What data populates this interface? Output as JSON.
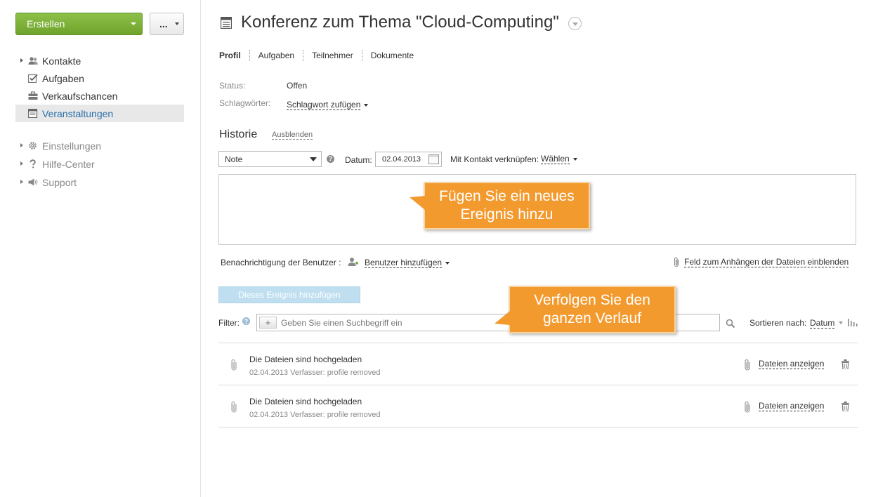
{
  "sidebar": {
    "create_label": "Erstellen",
    "more_label": "...",
    "items": [
      {
        "label": "Kontakte",
        "icon": "contacts-icon"
      },
      {
        "label": "Aufgaben",
        "icon": "tasks-icon"
      },
      {
        "label": "Verkaufschancen",
        "icon": "briefcase-icon"
      },
      {
        "label": "Veranstaltungen",
        "icon": "calendar-icon"
      }
    ],
    "secondary": [
      {
        "label": "Einstellungen",
        "icon": "gear-icon"
      },
      {
        "label": "Hilfe-Center",
        "icon": "question-icon"
      },
      {
        "label": "Support",
        "icon": "megaphone-icon"
      }
    ]
  },
  "header": {
    "title": "Konferenz zum Thema \"Cloud-Computing\""
  },
  "tabs": [
    "Profil",
    "Aufgaben",
    "Teilnehmer",
    "Dokumente"
  ],
  "profile": {
    "status_label": "Status:",
    "status_value": "Offen",
    "tags_label": "Schlagwörter:",
    "tags_value": "Schlagwort zufügen"
  },
  "history": {
    "title": "Historie",
    "hide_label": "Ausblenden",
    "type_value": "Note",
    "help_glyph": "?",
    "date_label": "Datum:",
    "date_value": "02.04.2013",
    "contact_label": "Mit Kontakt verknüpfen:",
    "contact_value": "Wählen",
    "notify_label": "Benachrichtigung der Benutzer :",
    "add_user_label": "Benutzer hinzufügen",
    "attach_toggle_label": "Feld zum Anhängen der Dateien einblenden",
    "add_event_label": "Dieses Ereignis hinzufügen",
    "filter_label": "Filter:",
    "filter_help_glyph": "?",
    "filter_plus": "+",
    "filter_placeholder": "Geben Sie einen Suchbegriff ein",
    "sort_label": "Sortieren nach:",
    "sort_value": "Datum",
    "entries": [
      {
        "title": "Die Dateien sind hochgeladen",
        "meta": "02.04.2013 Verfasser: profile removed",
        "files_link": "Dateien anzeigen"
      },
      {
        "title": "Die Dateien sind hochgeladen",
        "meta": "02.04.2013 Verfasser: profile removed",
        "files_link": "Dateien anzeigen"
      }
    ]
  },
  "callouts": {
    "add_event": "Fügen Sie ein neues Ereignis hinzu",
    "follow_history": "Verfolgen Sie den ganzen Verlauf"
  },
  "colors": {
    "create_button": "#7cb23a",
    "active_nav": "#2a6fa8",
    "callout": "#f39a2e",
    "add_event_button": "#bfdff0"
  }
}
